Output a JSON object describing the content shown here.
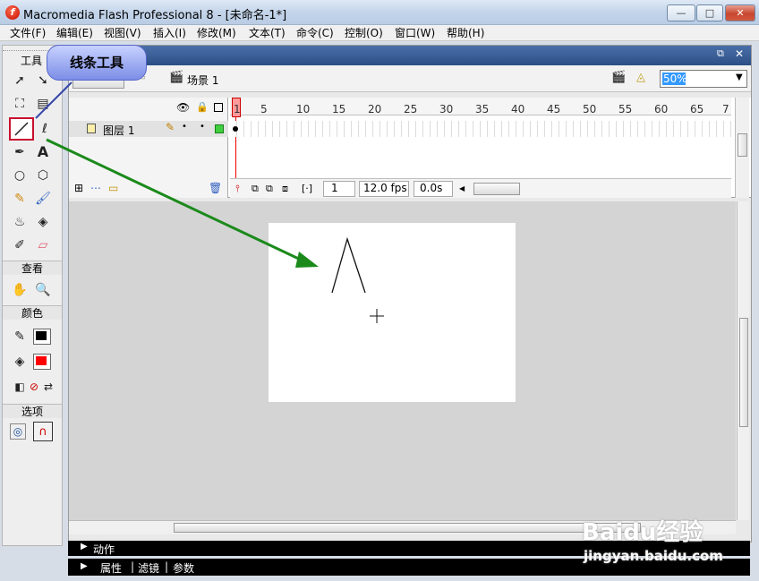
{
  "window": {
    "title": "Macromedia Flash Professional 8 - [未命名-1*]",
    "app_icon_glyph": "f",
    "controls": {
      "minimize": "—",
      "maximize": "□",
      "close": "✕"
    }
  },
  "menubar": {
    "items": [
      "文件(F)",
      "编辑(E)",
      "视图(V)",
      "插入(I)",
      "修改(M)",
      "文本(T)",
      "命令(C)",
      "控制(O)",
      "窗口(W)",
      "帮助(H)"
    ]
  },
  "toolbox": {
    "tools_header": "工具",
    "view_header": "查看",
    "color_header": "颜色",
    "options_header": "选项",
    "stroke_color": "#000000",
    "fill_color": "#ff0000"
  },
  "callout": {
    "text": "线条工具"
  },
  "document": {
    "controls": {
      "restore": "⧉",
      "close": "✕"
    }
  },
  "scene_bar": {
    "scene_label": "场景 1",
    "zoom_value": "50%"
  },
  "timeline": {
    "layer_name": "图层 1",
    "ruler_numbers": [
      "1",
      "5",
      "10",
      "15",
      "20",
      "25",
      "30",
      "35",
      "40",
      "45",
      "50",
      "55",
      "60",
      "65",
      "7"
    ],
    "current_frame": "1",
    "fps": "12.0 fps",
    "time": "0.0s"
  },
  "panels": {
    "actions_label": "动作",
    "props_tabs": [
      "属性",
      "滤镜",
      "参数"
    ]
  },
  "watermark": {
    "brand": "Baidu经验",
    "url": "jingyan.baidu.com"
  },
  "colors": {
    "highlight_red": "#c8102e",
    "arrow_green": "#1b8a1b",
    "callout_blue": "#7c8de6"
  }
}
